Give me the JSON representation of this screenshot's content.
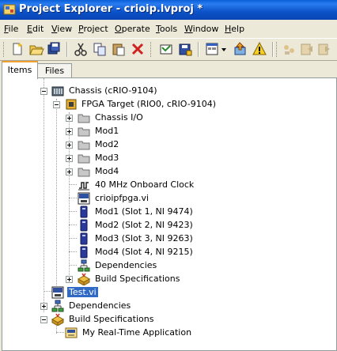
{
  "window": {
    "title": "Project Explorer - crioip.lvproj *"
  },
  "menu": [
    "File",
    "Edit",
    "View",
    "Project",
    "Operate",
    "Tools",
    "Window",
    "Help"
  ],
  "tabs": {
    "items": "Items",
    "files": "Files"
  },
  "tree": {
    "chassis": "Chassis (cRIO-9104)",
    "fpga_target": "FPGA Target (RIO0, cRIO-9104)",
    "chassis_io": "Chassis I/O",
    "mod1_folder": "Mod1",
    "mod2_folder": "Mod2",
    "mod3_folder": "Mod3",
    "mod4_folder": "Mod4",
    "clock": "40 MHz Onboard Clock",
    "fpga_vi": "crioipfpga.vi",
    "mod1": "Mod1 (Slot 1, NI 9474)",
    "mod2": "Mod2 (Slot 2, NI 9423)",
    "mod3": "Mod3 (Slot 3, NI 9263)",
    "mod4": "Mod4 (Slot 4, NI 9215)",
    "fpga_dependencies": "Dependencies",
    "fpga_build_specs": "Build Specifications",
    "test_vi": "Test.vi",
    "rt_dependencies": "Dependencies",
    "rt_build_specs": "Build Specifications",
    "rt_app": "My Real-Time Application"
  },
  "colors": {
    "title_bar": "#0b52c8",
    "selection": "#316ac5",
    "tab_highlight": "#f0a030"
  }
}
